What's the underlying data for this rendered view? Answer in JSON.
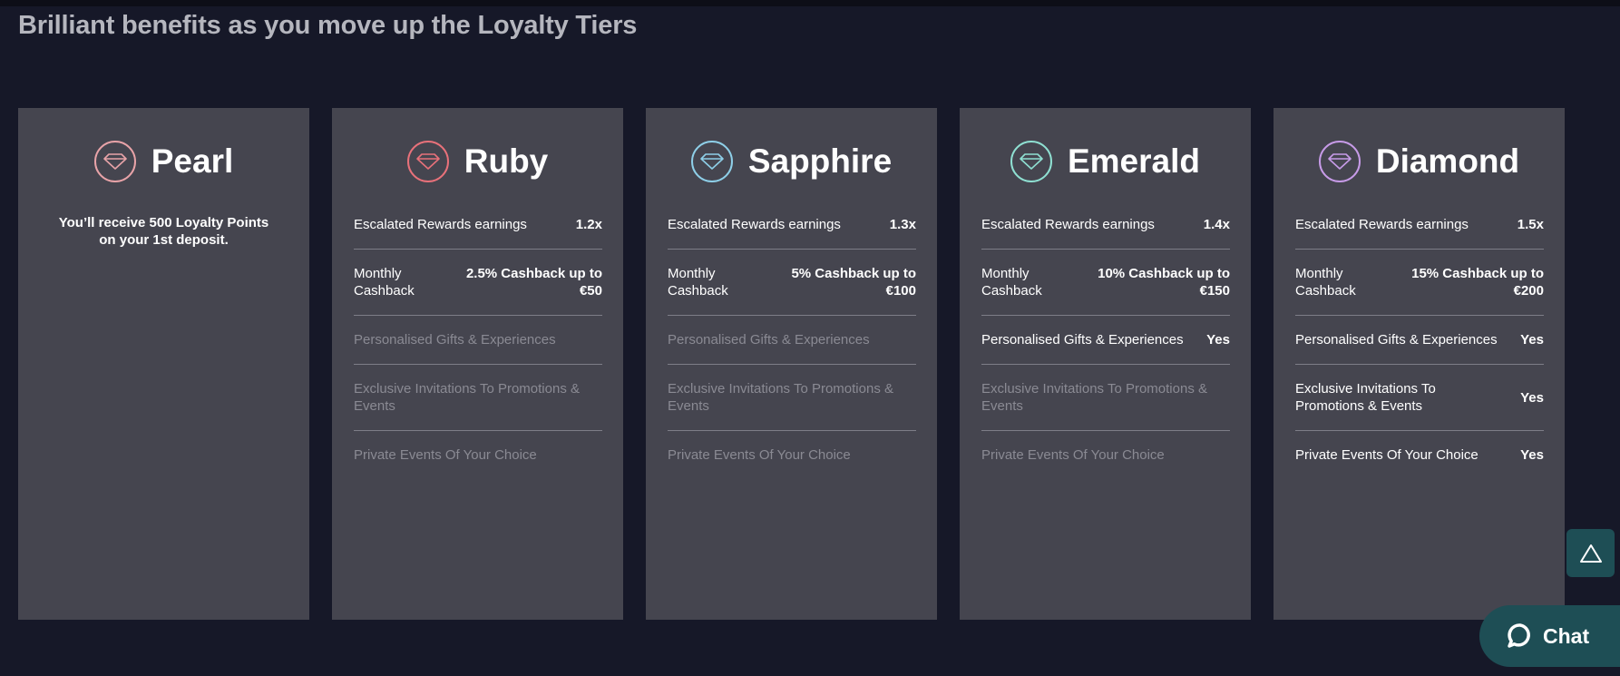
{
  "page": {
    "title": "Brilliant benefits as you move up the Loyalty Tiers"
  },
  "tiers": [
    {
      "name": "Pearl",
      "color": "#e8a3a8",
      "intro": "You’ll receive 500 Loyalty Points on your 1st deposit."
    },
    {
      "name": "Ruby",
      "color": "#e8717a",
      "rows": [
        {
          "label": "Escalated Rewards earnings",
          "value": "1.2x",
          "enabled": true
        },
        {
          "label": "Monthly Cashback",
          "value": "2.5% Cashback up to €50",
          "enabled": true
        },
        {
          "label": "Personalised Gifts & Experiences",
          "value": "",
          "enabled": false
        },
        {
          "label": "Exclusive Invitations To Promotions & Events",
          "value": "",
          "enabled": false
        },
        {
          "label": "Private Events Of Your Choice",
          "value": "",
          "enabled": false
        }
      ]
    },
    {
      "name": "Sapphire",
      "color": "#8ecfe8",
      "rows": [
        {
          "label": "Escalated Rewards earnings",
          "value": "1.3x",
          "enabled": true
        },
        {
          "label": "Monthly Cashback",
          "value": "5% Cashback up to €100",
          "enabled": true
        },
        {
          "label": "Personalised Gifts & Experiences",
          "value": "",
          "enabled": false
        },
        {
          "label": "Exclusive Invitations To Promotions & Events",
          "value": "",
          "enabled": false
        },
        {
          "label": "Private Events Of Your Choice",
          "value": "",
          "enabled": false
        }
      ]
    },
    {
      "name": "Emerald",
      "color": "#8fe0d2",
      "rows": [
        {
          "label": "Escalated Rewards earnings",
          "value": "1.4x",
          "enabled": true
        },
        {
          "label": "Monthly Cashback",
          "value": "10% Cashback up to €150",
          "enabled": true
        },
        {
          "label": "Personalised Gifts & Experiences",
          "value": "Yes",
          "enabled": true
        },
        {
          "label": "Exclusive Invitations To Promotions & Events",
          "value": "",
          "enabled": false
        },
        {
          "label": "Private Events Of Your Choice",
          "value": "",
          "enabled": false
        }
      ]
    },
    {
      "name": "Diamond",
      "color": "#c79be8",
      "rows": [
        {
          "label": "Escalated Rewards earnings",
          "value": "1.5x",
          "enabled": true
        },
        {
          "label": "Monthly Cashback",
          "value": "15% Cashback up to €200",
          "enabled": true
        },
        {
          "label": "Personalised Gifts & Experiences",
          "value": "Yes",
          "enabled": true
        },
        {
          "label": "Exclusive Invitations To Promotions & Events",
          "value": "Yes",
          "enabled": true
        },
        {
          "label": "Private Events Of Your Choice",
          "value": "Yes",
          "enabled": true
        }
      ]
    }
  ],
  "widgets": {
    "scroll_top_icon": "triangle-up-icon",
    "chat_icon": "chat-bubble-icon",
    "chat_label": "Chat"
  }
}
